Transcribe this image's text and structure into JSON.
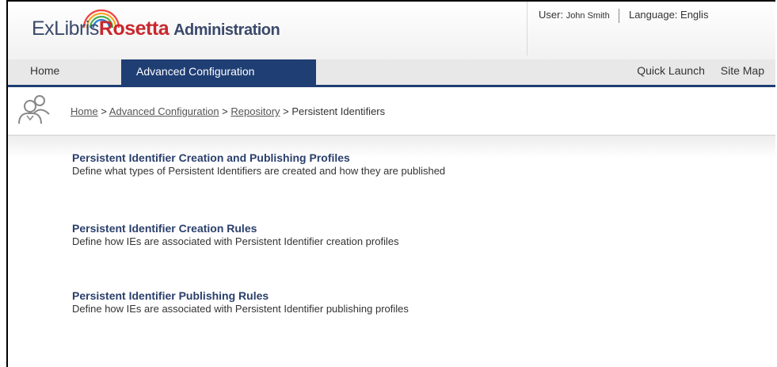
{
  "header": {
    "logo_exlibris": "ExLibris",
    "logo_rosetta": "Rosetta",
    "logo_admin": "Administration",
    "user_label": "User:",
    "user_name": "John Smith",
    "language_label": "Language: Englis"
  },
  "nav": {
    "home": "Home",
    "advanced_configuration": "Advanced Configuration",
    "quick_launch": "Quick Launch",
    "site_map": "Site Map"
  },
  "breadcrumb": {
    "home": "Home",
    "advanced_configuration": "Advanced Configuration",
    "repository": "Repository",
    "current": "Persistent Identifiers",
    "separator": " > "
  },
  "items": [
    {
      "title": "Persistent Identifier Creation and Publishing Profiles",
      "description": "Define what types of Persistent Identifiers are created and how they are published"
    },
    {
      "title": "Persistent Identifier Creation Rules",
      "description": "Define how IEs are associated with Persistent Identifier creation profiles"
    },
    {
      "title": "Persistent Identifier Publishing Rules",
      "description": "Define how IEs are associated with Persistent Identifier publishing profiles"
    }
  ],
  "colors": {
    "nav_active": "#1f3e74",
    "link_title": "#2a3f6b",
    "brand_red": "#c8282d"
  }
}
